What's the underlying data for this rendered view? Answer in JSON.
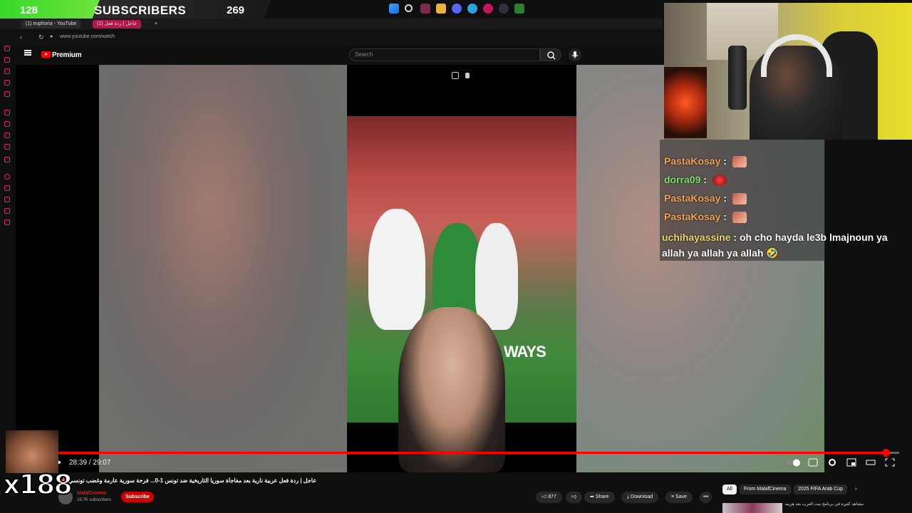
{
  "overlay": {
    "subscriber_count": "128",
    "subscriber_label": "SUBSCRIBERS",
    "subscriber_goal": "269",
    "reaction_multiplier": "x188"
  },
  "browser": {
    "tabs": [
      {
        "label": "(1) euphoria - YouTube"
      },
      {
        "label": "(1) عاجل | ردة فعل"
      }
    ],
    "url": "www.youtube.com/watch"
  },
  "youtube": {
    "brand": "Premium",
    "search_placeholder": "Search"
  },
  "player": {
    "time": "28:39 / 29:07",
    "progress": 0.984,
    "watermark_text": "WAYS"
  },
  "video": {
    "title": "عاجل | ردة فعل عربية نارية بعد مفاجأة سوريا التاريخية ضد تونس 1-0... فرحة سورية عارمة وغضب تونسي 🔥",
    "channel_name": "MalafCinema",
    "channel_subs": "15.7K subscribers",
    "subscribe_label": "Subscribe",
    "likes": "877",
    "share_label": "Share",
    "download_label": "Download",
    "save_label": "Save"
  },
  "recommendations": {
    "chips": [
      "All",
      "From MalafCinema",
      "2025 FIFA Arab Cup"
    ],
    "first_title": "مشاهد كثيرة في برنامج بيت العرب بعد هزيمة"
  },
  "chat": {
    "lines": [
      {
        "user": "PastaKosay",
        "sep": ":"
      },
      {
        "user": "dorra09",
        "sep": ":"
      },
      {
        "user": "PastaKosay",
        "sep": ":"
      },
      {
        "user": "PastaKosay",
        "sep": ":"
      }
    ],
    "message_user": "uchihayassine",
    "message_text": " : oh cho hayda le3b lmajnoun ya allah ya allah ya allah 🤣"
  },
  "colors": {
    "accent": "#ff0000",
    "chat_user_orange": "#f2a45a",
    "chat_user_green": "#7ee06a",
    "chat_user_yellow": "#ecd869"
  }
}
